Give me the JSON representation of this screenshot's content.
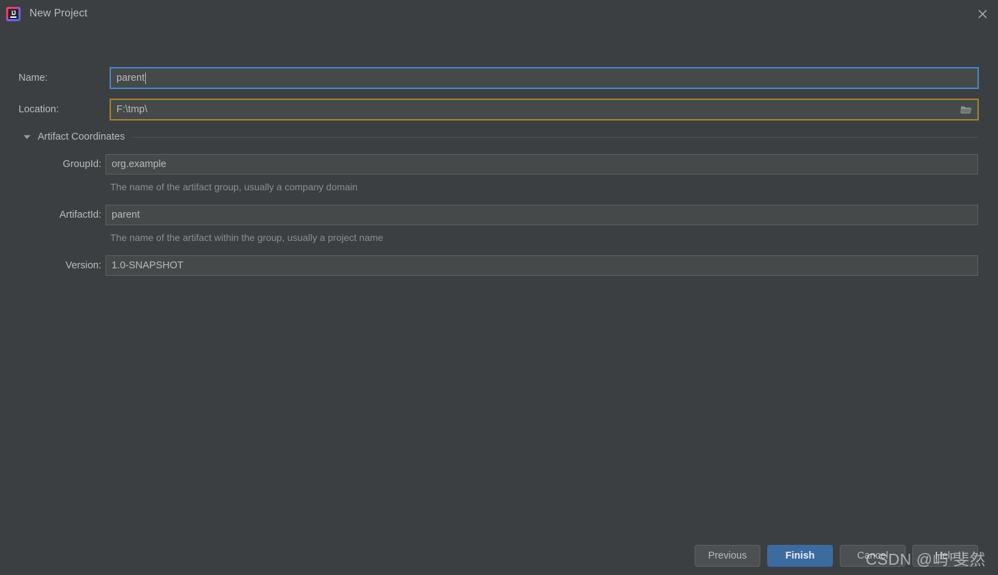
{
  "window": {
    "title": "New Project",
    "app_icon": "intellij-idea-icon",
    "close_icon": "close-icon"
  },
  "form": {
    "name": {
      "label": "Name:",
      "value": "parent",
      "state": "focused",
      "border_color": "#4a88c7"
    },
    "location": {
      "label": "Location:",
      "value": "F:\\tmp\\",
      "state": "warning",
      "border_color": "#a8842a",
      "browse_icon": "folder-open-icon"
    }
  },
  "section": {
    "title": "Artifact Coordinates",
    "expanded": true,
    "twisty_icon": "chevron-down-icon"
  },
  "artifact": {
    "groupid": {
      "label": "GroupId:",
      "value": "org.example",
      "hint": "The name of the artifact group, usually a company domain"
    },
    "artifactid": {
      "label": "ArtifactId:",
      "value": "parent",
      "hint": "The name of the artifact within the group, usually a project name"
    },
    "version": {
      "label": "Version:",
      "value": "1.0-SNAPSHOT"
    }
  },
  "footer": {
    "previous": "Previous",
    "finish": "Finish",
    "cancel": "Cancel",
    "help": "Help"
  },
  "watermark": {
    "text": "CSDN @屿 斐然"
  },
  "colors": {
    "window_bg": "#3c3f41",
    "field_bg": "#45494a",
    "field_border": "#5e6060",
    "text": "#bbbbbb",
    "hint_text": "#8c8f91",
    "accent_blue": "#3c6ba0",
    "focus_blue": "#4a88c7",
    "warn_amber": "#a8842a"
  }
}
